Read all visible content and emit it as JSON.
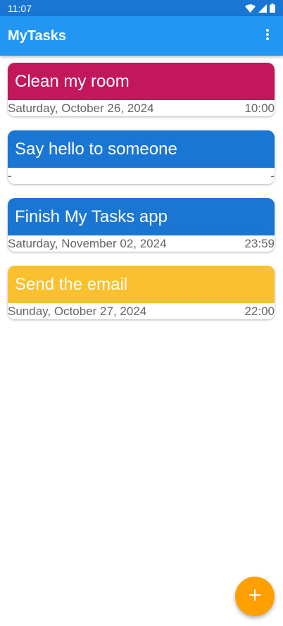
{
  "status_bar": {
    "time": "11:07",
    "icons": [
      "wifi-icon",
      "signal-icon",
      "battery-icon"
    ]
  },
  "app_bar": {
    "title": "MyTasks",
    "menu_icon": "more-vert-icon"
  },
  "colors": {
    "status_bar": "#1976D2",
    "app_bar": "#2196F3",
    "fab": "#FFA000"
  },
  "tasks": [
    {
      "title": "Clean my room",
      "date": "Saturday, October 26, 2024",
      "time": "10:00",
      "color": "#C2185B"
    },
    {
      "title": "Say hello to someone",
      "date": "-",
      "time": "-",
      "color": "#1976D2"
    },
    {
      "title": "Finish My Tasks app",
      "date": "Saturday, November 02, 2024",
      "time": "23:59",
      "color": "#1976D2"
    },
    {
      "title": "Send the email",
      "date": "Sunday, October 27, 2024",
      "time": "22:00",
      "color": "#FBC02D"
    }
  ],
  "fab": {
    "icon": "plus-icon"
  }
}
